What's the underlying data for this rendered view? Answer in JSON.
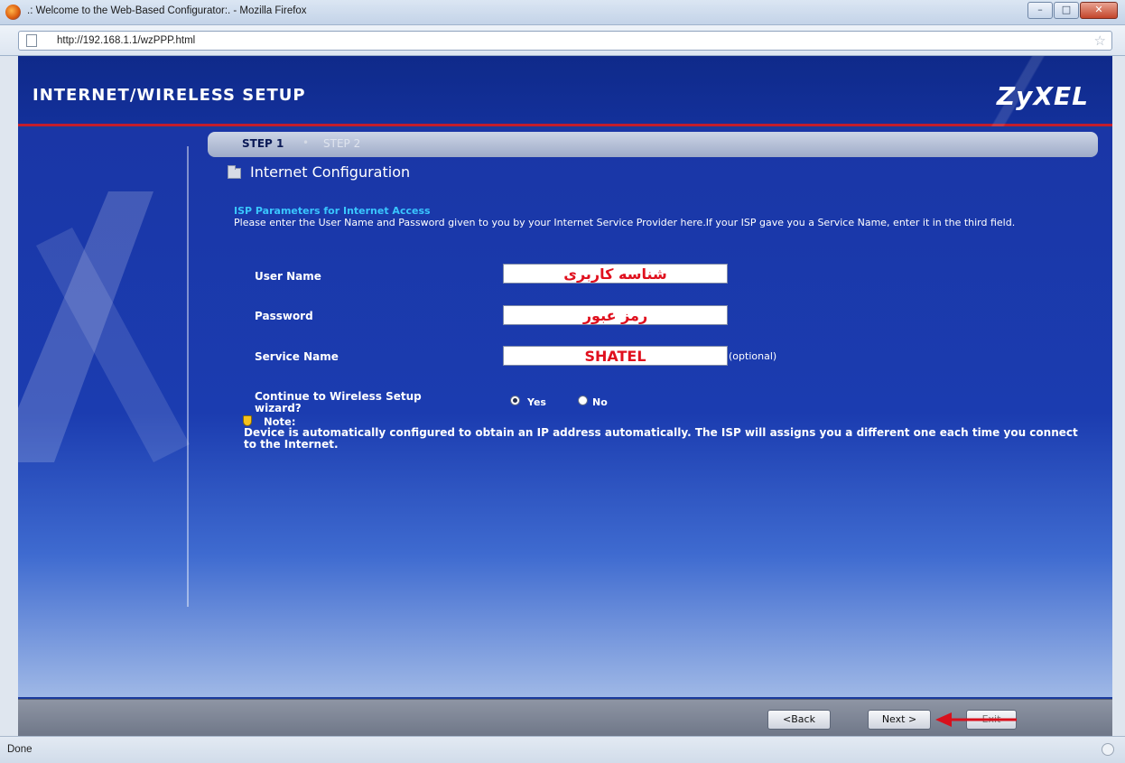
{
  "window": {
    "title": ".: Welcome to the Web-Based Configurator:. - Mozilla Firefox",
    "minimize": "–",
    "maximize": "□",
    "close": "✕"
  },
  "browser": {
    "url": "http://192.168.1.1/wzPPP.html",
    "status": "Done"
  },
  "banner": {
    "title": "INTERNET/WIRELESS SETUP",
    "logo": "ZyXEL"
  },
  "steps": {
    "step1": "STEP 1",
    "separator": "•",
    "step2": "STEP 2"
  },
  "section": {
    "title": "Internet Configuration"
  },
  "isp": {
    "heading": "ISP Parameters for Internet Access",
    "description": "Please enter the User Name and Password given to you by your Internet Service Provider here.If your ISP gave you a Service Name, enter it in the third field."
  },
  "form": {
    "user_name_label": "User Name",
    "user_name_value": "شناسه کاربری",
    "password_label": "Password",
    "password_value": "رمز عبور",
    "service_name_label": "Service Name",
    "service_name_value": "SHATEL",
    "optional": "(optional)",
    "wizard_label": "Continue to Wireless Setup wizard?",
    "yes": "Yes",
    "no": "No",
    "wizard_selected": "Yes"
  },
  "note": {
    "label": "Note:",
    "text": "Device is automatically configured to obtain an IP address automatically. The ISP will assigns you a different one each time you connect to the Internet."
  },
  "buttons": {
    "back": "<Back",
    "next": "Next >",
    "exit": "Exit"
  },
  "colors": {
    "banner": "#0f2a8a",
    "accent_red": "#c21d2c",
    "heading_cyan": "#39c6ff",
    "annotation_red": "#e0101e"
  },
  "icons": {
    "folder": "folder-icon",
    "note": "note-icon",
    "arrow": "arrow-annotation-icon"
  }
}
